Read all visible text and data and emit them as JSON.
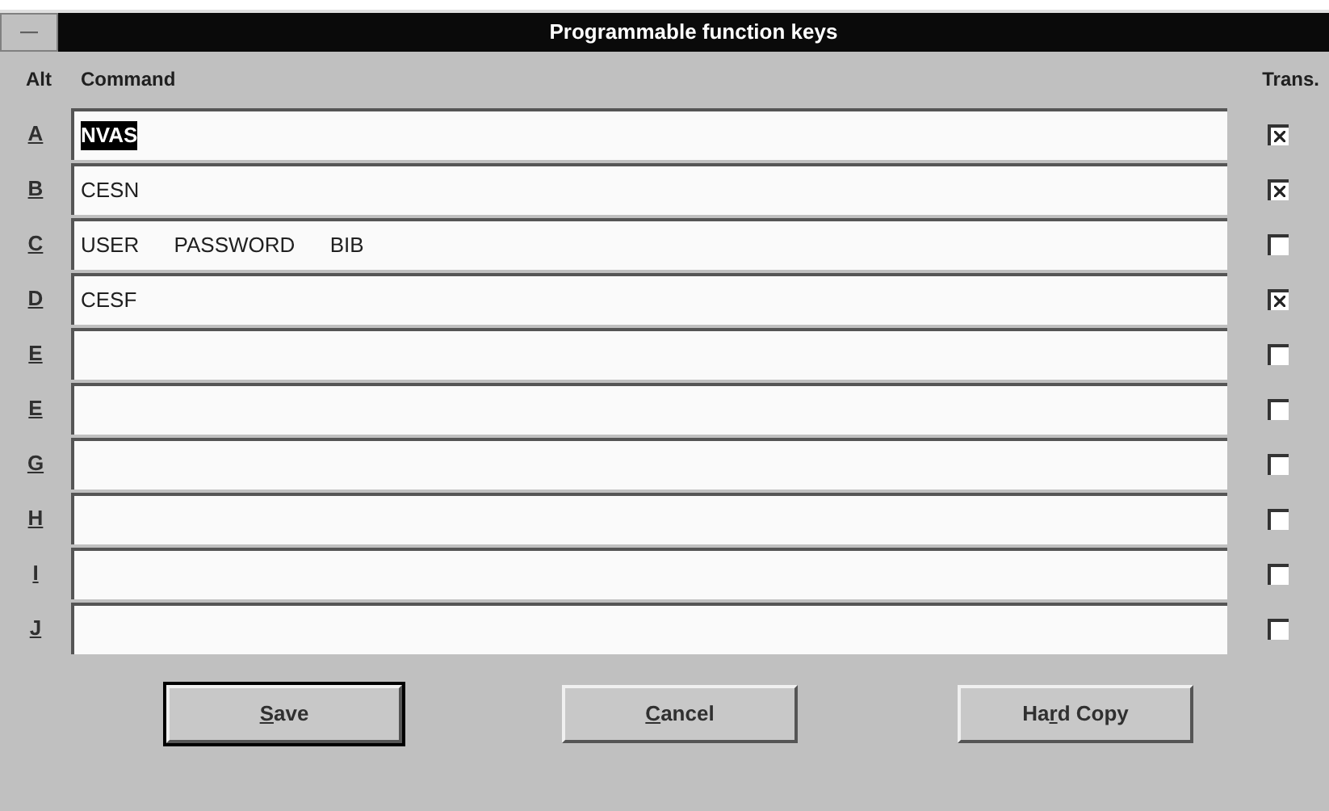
{
  "window": {
    "title": "Programmable function keys",
    "system_menu": "—"
  },
  "headers": {
    "alt": "Alt",
    "command": "Command",
    "trans": "Trans."
  },
  "rows": [
    {
      "key": "A",
      "command": "NVAS",
      "text_selected": true,
      "trans": true
    },
    {
      "key": "B",
      "command": "CESN",
      "text_selected": false,
      "trans": true
    },
    {
      "key": "C",
      "command": "USER      PASSWORD      BIB",
      "text_selected": false,
      "trans": false
    },
    {
      "key": "D",
      "command": "CESF",
      "text_selected": false,
      "trans": true
    },
    {
      "key": "E",
      "text_selected": false,
      "trans": false
    },
    {
      "key": "E",
      "text_selected": false,
      "trans": false
    },
    {
      "key": "G",
      "text_selected": false,
      "trans": false
    },
    {
      "key": "H",
      "text_selected": false,
      "trans": false
    },
    {
      "key": "I",
      "text_selected": false,
      "trans": false
    },
    {
      "key": "J",
      "text_selected": false,
      "trans": false
    }
  ],
  "buttons": [
    {
      "mnemonic": "S",
      "rest": "ave",
      "default": true
    },
    {
      "mnemonic": "C",
      "rest": "ancel",
      "default": false
    },
    {
      "lead": "Ha",
      "mnemonic": "r",
      "rest": "d Copy",
      "default": false
    }
  ]
}
